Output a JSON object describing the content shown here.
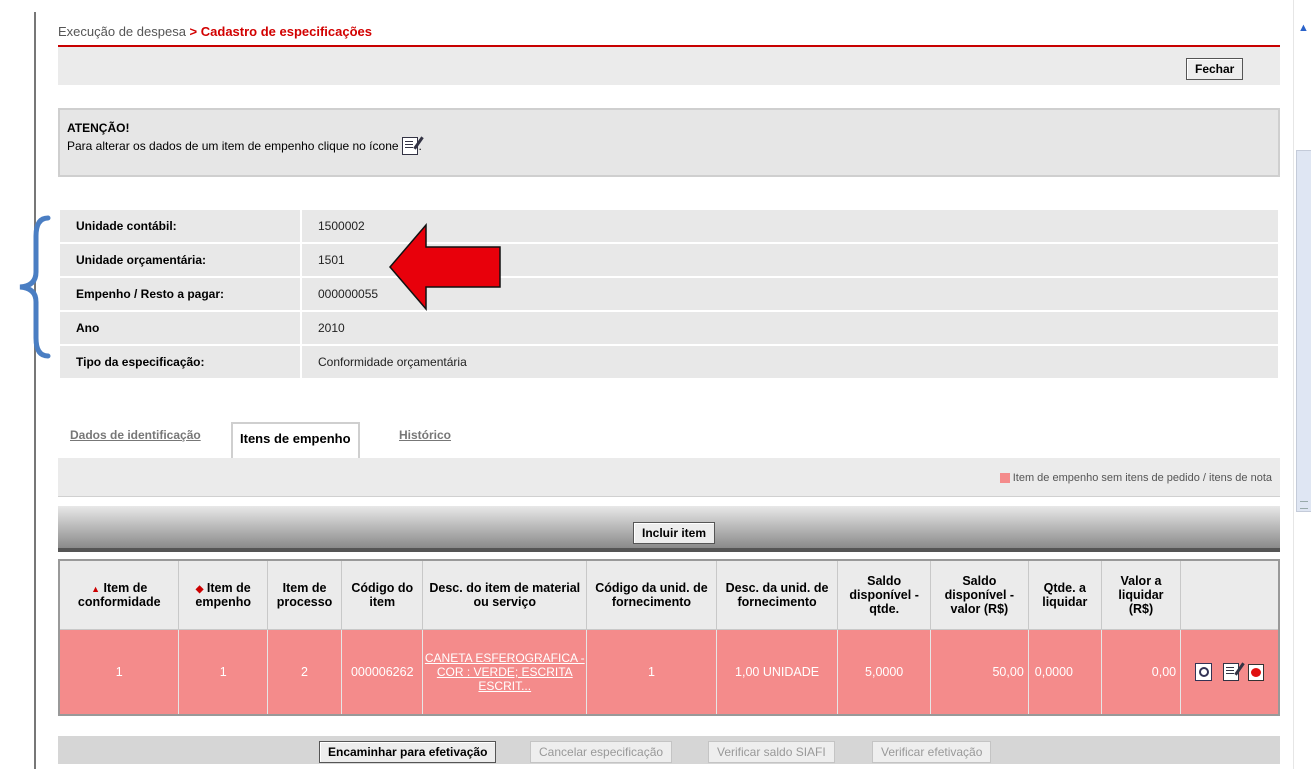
{
  "breadcrumb": {
    "parent": "Execução de despesa",
    "separator": " > ",
    "current": "Cadastro de especificações"
  },
  "toolbar": {
    "close_label": "Fechar"
  },
  "attention": {
    "title": "ATENÇÃO!",
    "message": "Para alterar os dados de um item de empenho clique no ícone",
    "suffix": "."
  },
  "info": [
    {
      "label": "Unidade contábil:",
      "value": "1500002"
    },
    {
      "label": "Unidade orçamentária:",
      "value": "1501"
    },
    {
      "label": "Empenho / Resto a pagar:",
      "value": "000000055"
    },
    {
      "label": "Ano",
      "value": "2010"
    },
    {
      "label": "Tipo da especificação:",
      "value": "Conformidade orçamentária"
    }
  ],
  "tabs": [
    {
      "label": "Dados de identificação",
      "active": false
    },
    {
      "label": "Itens de empenho",
      "active": true
    },
    {
      "label": "Histórico",
      "active": false
    }
  ],
  "legend": {
    "label": "Item de empenho sem itens de pedido / itens de nota",
    "color": "#f48b8b"
  },
  "include_item_label": "Incluir item",
  "table": {
    "headers": [
      "Item de conformidade",
      "Item de empenho",
      "Item de processo",
      "Código do item",
      "Desc. do item de material ou serviço",
      "Código da unid. de fornecimento",
      "Desc. da unid. de fornecimento",
      "Saldo disponível - qtde.",
      "Saldo disponível - valor (R$)",
      "Qtde. a liquidar",
      "Valor a liquidar (R$)"
    ],
    "sort_icons": {
      "up": "▲",
      "both": "◆"
    },
    "rows": [
      {
        "item_conformidade": "1",
        "item_empenho": "1",
        "item_processo": "2",
        "codigo_item": "000006262",
        "descricao": "CANETA ESFEROGRAFICA - COR : VERDE; ESCRITA ESCRIT...",
        "codigo_unid": "1",
        "desc_unid": "1,00 UNIDADE",
        "saldo_qtde": "5,0000",
        "saldo_valor": "50,00",
        "qtde_liquidar": "0,0000",
        "valor_liquidar": "0,00",
        "icons": [
          "view-icon",
          "edit-icon",
          "delete-icon"
        ]
      }
    ]
  },
  "bottom_actions": [
    {
      "label": "Encaminhar para efetivação",
      "enabled": true
    },
    {
      "label": "Cancelar especificação",
      "enabled": false
    },
    {
      "label": "Verificar saldo SIAFI",
      "enabled": false
    },
    {
      "label": "Verificar efetivação",
      "enabled": false
    }
  ],
  "annotations": {
    "brace_color": "#4a7ec3",
    "arrow_color": "#e8000b"
  }
}
